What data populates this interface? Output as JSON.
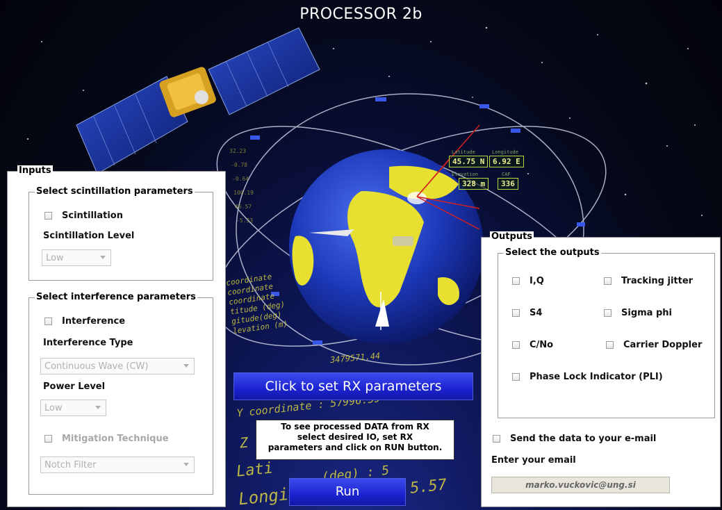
{
  "window": {
    "title": "PROCESSOR 2b"
  },
  "inputs": {
    "panel_title": "Inputs",
    "scintillation_group": {
      "legend": "Select scintillation parameters",
      "checkbox_label": "Scintillation",
      "level_label": "Scintillation Level",
      "level_value": "Low"
    },
    "interference_group": {
      "legend": "Select interference parameters",
      "checkbox_label": "Interference",
      "type_label": "Interference Type",
      "type_value": "Continuous Wave (CW)",
      "power_label": "Power Level",
      "power_value": "Low",
      "mitigation_label": "Mitigation Technique",
      "mitigation_value": "Notch Filter"
    }
  },
  "outputs": {
    "panel_title": "Outputs",
    "legend": "Select the outputs",
    "items": [
      {
        "label": "I,Q",
        "checked": false
      },
      {
        "label": "Tracking jitter",
        "checked": false
      },
      {
        "label": "S4",
        "checked": false
      },
      {
        "label": "Sigma phi",
        "checked": false
      },
      {
        "label": "C/No",
        "checked": false
      },
      {
        "label": "Carrier Doppler",
        "checked": false
      },
      {
        "label": "Phase Lock Indicator (PLI)",
        "checked": false
      }
    ],
    "send_email_label": "Send the data to your e-mail",
    "email_label": "Enter your email",
    "email_value": "marko.vuckovic@ung.si"
  },
  "actions": {
    "rx_button": "Click to set RX parameters",
    "run_button": "Run",
    "info_line1": "To see processed DATA from RX",
    "info_line2": "select desired IO, set RX",
    "info_line3": "parameters and click on RUN button."
  },
  "hud": {
    "latitude_caption": "Latitude",
    "latitude": "45.75 N",
    "longitude_caption": "Longitude",
    "longitude": "6.92 E",
    "elevation_caption": "Elevation",
    "elevation": "328 m",
    "fourth_caption": "CAF",
    "fourth": "336"
  },
  "background_text": {
    "y_coordinate": "Y coordinate : 57996.59",
    "z_coord": "Z",
    "latitude_partial": "Lati",
    "longitude_partial": "Longit",
    "deg_fragment": ".(deg) : 5",
    "lon_value": "5.57",
    "small_value": "3479571.44",
    "list_lines": [
      "coordinate",
      "coordinate",
      "coordinate",
      "titude (deg)",
      "gitude(deg)",
      "levation (m)"
    ]
  },
  "colors": {
    "button_blue": "#1c23d0",
    "space_dark": "#050818",
    "earth_ocean": "#1f3fbf",
    "earth_land": "#e8e030"
  }
}
